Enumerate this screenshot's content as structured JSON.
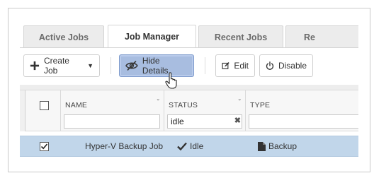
{
  "tabs": [
    {
      "label": "Active Jobs",
      "active": false
    },
    {
      "label": "Job Manager",
      "active": true
    },
    {
      "label": "Recent Jobs",
      "active": false
    },
    {
      "label": "Re",
      "active": false
    }
  ],
  "toolbar": {
    "create_job_label": "Create Job",
    "create_job_caret": "▼",
    "hide_details_label": "Hide Details",
    "edit_label": "Edit",
    "disable_label": "Disable"
  },
  "grid": {
    "columns": [
      {
        "header": "NAME",
        "sort_glyph": "ˇ",
        "filter_value": ""
      },
      {
        "header": "STATUS",
        "sort_glyph": "ˇ",
        "filter_value": "idle",
        "clear_glyph": "✖"
      },
      {
        "header": "TYPE",
        "filter_value": ""
      }
    ],
    "rows": [
      {
        "selected": true,
        "name": "Hyper-V Backup Job",
        "status": "Idle",
        "type": "Backup"
      }
    ]
  },
  "icons": {
    "create_job": "plus-icon",
    "hide_details": "eye-slash-icon",
    "edit": "edit-icon",
    "disable": "power-icon",
    "status": "checkmark-icon",
    "type": "backup-file-icon",
    "cursor": "hand-pointer-icon"
  },
  "colors": {
    "selected_row": "#c1d6ea",
    "highlight_button": "#a8bde0"
  }
}
